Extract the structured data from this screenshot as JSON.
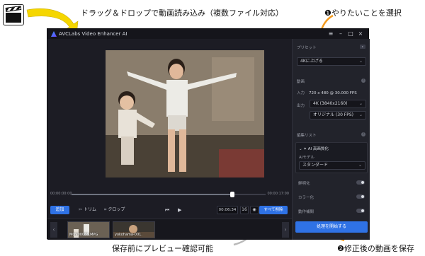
{
  "annotations": {
    "top": "ドラッグ＆ドロップで動画読み込み（複数ファイル対応）",
    "right_top": "❶やりたいことを選択",
    "right_bottom": "❷修正後の動画を保存",
    "bottom": "保存前にプレビュー確認可能",
    "colors": {
      "arrow": "#f5d600",
      "callout_arrow": "#f39a1e"
    }
  },
  "app": {
    "title": "AVCLabs Video Enhancer AI",
    "window_controls": [
      "≡",
      "–",
      "□",
      "×"
    ],
    "timeline": {
      "start": "00:00:00:00",
      "end": "00:00:17:00",
      "progress": 0.83
    },
    "controls": {
      "add_label": "追加",
      "trim_label": "トリム",
      "crop_label": "クロップ",
      "timecode": "00:06:34",
      "box_label": "16",
      "export_all_label": "すべて削除"
    },
    "filmstrip": [
      {
        "label": "MOV00066.MPG"
      },
      {
        "label": "yokohama-001."
      }
    ],
    "sidebar": {
      "preset_label": "プリセット",
      "preset_value": "4Kに上げる",
      "output_label": "動画",
      "input_key": "入力",
      "input_value": "720 x 480 @ 30.000 FPS",
      "output_key": "出力",
      "output_resolution": "4K (3840x2160)",
      "output_fps": "オリジナル (30 FPS)",
      "pipeline_label": "編集リスト",
      "pipeline_head": "AI 高画質化",
      "ai_model_label": "AIモデル",
      "ai_model_value": "スタンダード",
      "toggles": [
        "鮮明化",
        "カラー化",
        "動作補間"
      ],
      "start_label": "処理を開始する"
    },
    "colors": {
      "accent": "#2f72e5",
      "bg": "#1c1c24",
      "panel": "#22232b"
    }
  }
}
